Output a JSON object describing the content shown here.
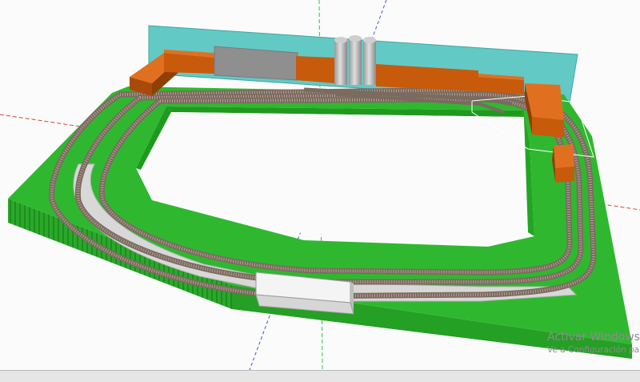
{
  "watermark": {
    "title": "Activar Windows",
    "subtitle": "Ve a Configuración pa"
  },
  "colors": {
    "grass": "#2fb82f",
    "grass_dark": "#1f9a1f",
    "backdrop": "#63c9c5",
    "building": "#c85a0c",
    "building_dark": "#8f3f07",
    "grey_building": "#8f8f8f",
    "silo": "#b7b7b7",
    "platform": "#d8d8d8",
    "track": "#8a7a70",
    "axis_red": "#d94040",
    "axis_green": "#2ec24a",
    "axis_blue": "#3c5ac8"
  }
}
